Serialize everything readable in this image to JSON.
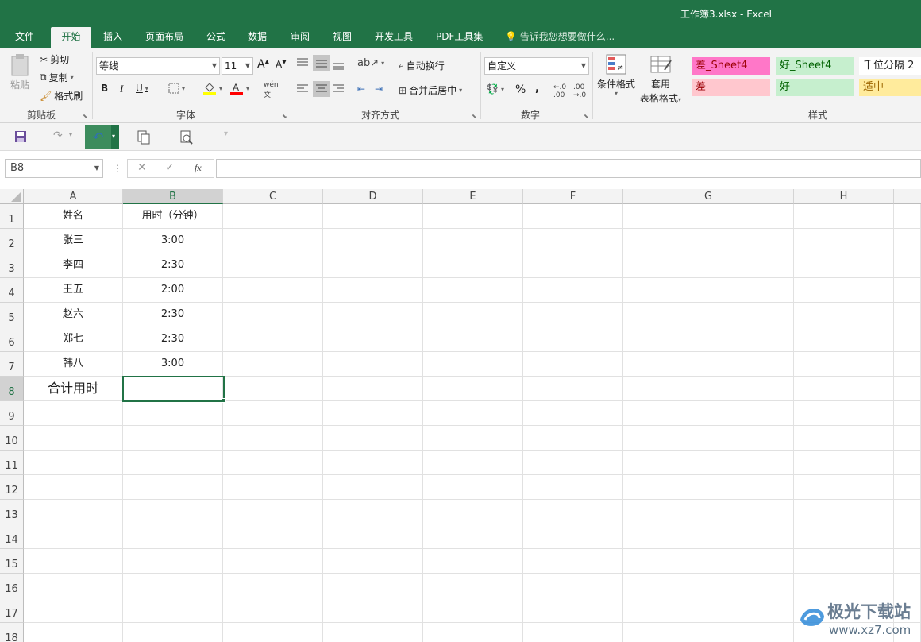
{
  "window": {
    "title": "工作簿3.xlsx - Excel"
  },
  "tabs": [
    "文件",
    "开始",
    "插入",
    "页面布局",
    "公式",
    "数据",
    "审阅",
    "视图",
    "开发工具",
    "PDF工具集"
  ],
  "tell_me": "告诉我您想要做什么...",
  "ribbon": {
    "clipboard": {
      "paste": "粘贴",
      "cut": "剪切",
      "copy": "复制",
      "format_painter": "格式刷",
      "label": "剪贴板"
    },
    "font": {
      "name": "等线",
      "size": "11",
      "bold": "B",
      "italic": "I",
      "underline": "U",
      "label": "字体"
    },
    "alignment": {
      "wrap": "自动换行",
      "merge": "合并后居中",
      "label": "对齐方式"
    },
    "number": {
      "format": "自定义",
      "percent": "%",
      "comma": ",",
      "label": "数字"
    },
    "styles": {
      "conditional": "条件格式",
      "table_line1": "套用",
      "table_line2": "表格格式",
      "cells": [
        {
          "text": "差_Sheet4",
          "bg": "#ff77c8",
          "fg": "#9c0006"
        },
        {
          "text": "好_Sheet4",
          "bg": "#c6efce",
          "fg": "#006100"
        },
        {
          "text": "千位分隔 2",
          "bg": "#ffffff",
          "fg": "#222222"
        },
        {
          "text": "差",
          "bg": "#ffc7ce",
          "fg": "#9c0006"
        },
        {
          "text": "好",
          "bg": "#c6efce",
          "fg": "#006100"
        },
        {
          "text": "适中",
          "bg": "#ffeb9c",
          "fg": "#9c6500"
        }
      ],
      "label": "样式"
    }
  },
  "formula_bar": {
    "name_box": "B8",
    "value": ""
  },
  "columns": [
    "A",
    "B",
    "C",
    "D",
    "E",
    "F",
    "G",
    "H"
  ],
  "rows": [
    "1",
    "2",
    "3",
    "4",
    "5",
    "6",
    "7",
    "8",
    "9",
    "10",
    "11",
    "12",
    "13",
    "14",
    "15",
    "16",
    "17",
    "18"
  ],
  "cells": {
    "A": [
      "姓名",
      "张三",
      "李四",
      "王五",
      "赵六",
      "郑七",
      "韩八",
      "合计用时"
    ],
    "B": [
      "用时（分钟）",
      "3:00",
      "2:30",
      "2:00",
      "2:30",
      "2:30",
      "3:00",
      ""
    ]
  },
  "watermark": {
    "text": "极光下载站",
    "url": "www.xz7.com"
  }
}
